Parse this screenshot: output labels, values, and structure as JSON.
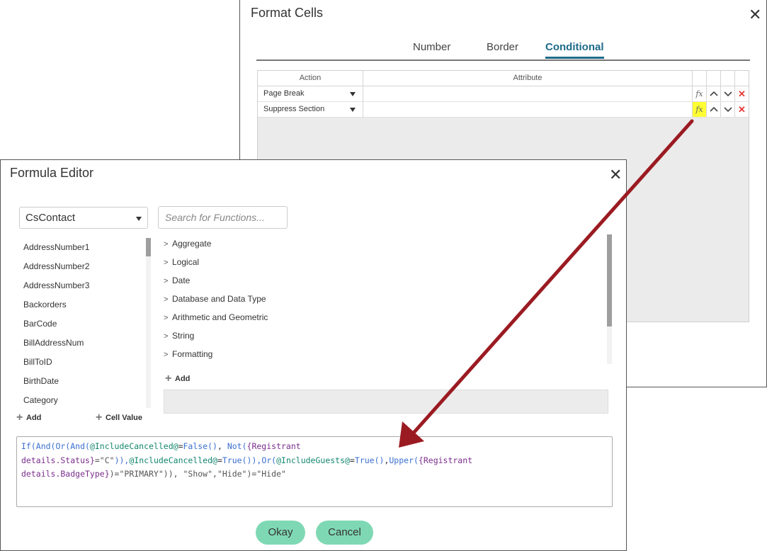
{
  "format_cells": {
    "title": "Format Cells",
    "close_glyph": "✕",
    "tabs": [
      {
        "label": "Number",
        "active": false
      },
      {
        "label": "Border",
        "active": false
      },
      {
        "label": "Conditional",
        "active": true
      }
    ],
    "grid": {
      "headers": {
        "action": "Action",
        "attribute": "Attribute"
      },
      "rows": [
        {
          "action": "Page Break",
          "attribute": "",
          "fx": "fx",
          "fx_highlighted": false
        },
        {
          "action": "Suppress Section",
          "attribute": "",
          "fx": "fx",
          "fx_highlighted": true
        }
      ],
      "highlight_color": "#ffff33",
      "delete_color": "#e53935"
    }
  },
  "formula_editor": {
    "title": "Formula Editor",
    "close_glyph": "✕",
    "table_select": {
      "value": "CsContact"
    },
    "search": {
      "placeholder": "Search for Functions..."
    },
    "fields": [
      "AddressNumber1",
      "AddressNumber2",
      "AddressNumber3",
      "Backorders",
      "BarCode",
      "BillAddressNum",
      "BillToID",
      "BirthDate",
      "Category"
    ],
    "functions": [
      "Aggregate",
      "Logical",
      "Date",
      "Database and Data Type",
      "Arithmetic and Geometric",
      "String",
      "Formatting"
    ],
    "add_function_label": "Add",
    "add_field_label": "Add",
    "cell_value_label": "Cell Value",
    "formula": {
      "line1": [
        {
          "t": "If(And(Or(And(",
          "c": "fn"
        },
        {
          "t": "@IncludeCancelled@",
          "c": "var"
        },
        {
          "t": "=",
          "c": "op"
        },
        {
          "t": "False()",
          "c": "fn"
        },
        {
          "t": ", ",
          "c": "op"
        },
        {
          "t": "Not(",
          "c": "fn"
        },
        {
          "t": "{Registrant",
          "c": "fld"
        }
      ],
      "line2": [
        {
          "t": "details.Status}",
          "c": "fld"
        },
        {
          "t": "=\"C\"",
          "c": "str"
        },
        {
          "t": ")),",
          "c": "fn"
        },
        {
          "t": "@IncludeCancelled@",
          "c": "var"
        },
        {
          "t": "=",
          "c": "op"
        },
        {
          "t": "True()",
          "c": "fn"
        },
        {
          "t": "),",
          "c": "fn"
        },
        {
          "t": "Or(",
          "c": "fn"
        },
        {
          "t": "@IncludeGuests@",
          "c": "var"
        },
        {
          "t": "=",
          "c": "op"
        },
        {
          "t": "True()",
          "c": "fn"
        },
        {
          "t": ",",
          "c": "op"
        },
        {
          "t": "Upper(",
          "c": "fn"
        },
        {
          "t": "{Registrant",
          "c": "fld"
        }
      ],
      "line3": [
        {
          "t": "details.BadgeType}",
          "c": "fld"
        },
        {
          "t": ")=\"PRIMARY\")), \"Show\",\"Hide\")=\"Hide\"",
          "c": "str"
        }
      ]
    },
    "okay_label": "Okay",
    "cancel_label": "Cancel",
    "button_color": "#7fd8b4"
  },
  "annotation": {
    "arrow_color": "#9b1b22"
  }
}
